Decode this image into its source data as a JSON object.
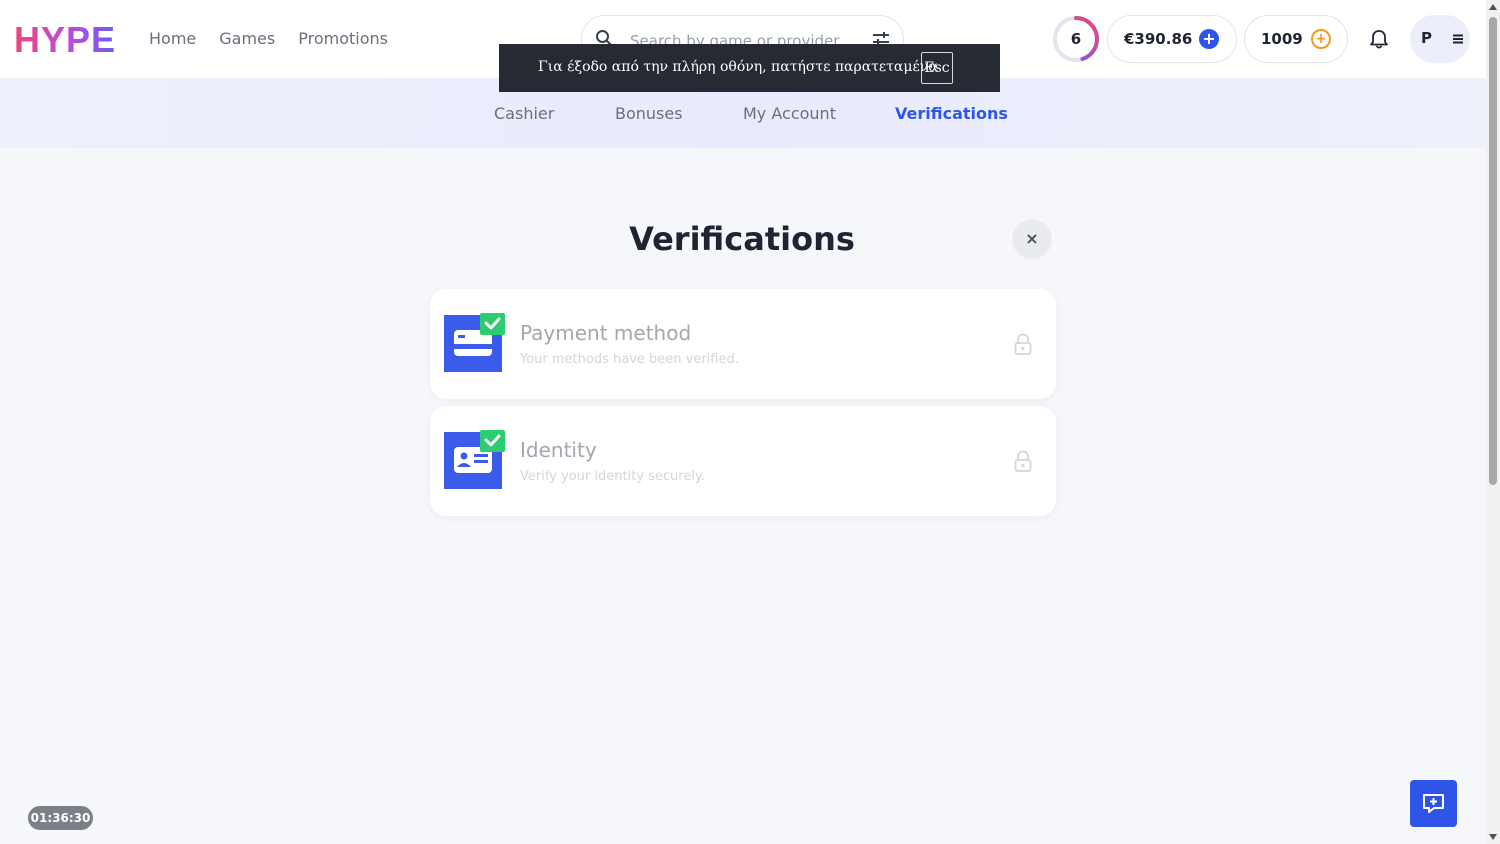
{
  "brand": {
    "logo_text": "HYPE"
  },
  "nav": {
    "items": [
      {
        "label": "Home"
      },
      {
        "label": "Games"
      },
      {
        "label": "Promotions"
      }
    ]
  },
  "search": {
    "placeholder": "Search by game or provider",
    "value": ""
  },
  "account": {
    "level": "6",
    "level_progress": 0.45,
    "balance": "€390.86",
    "points": "1009",
    "avatar_initial": "P"
  },
  "fullscreen_toast": {
    "message": "Για έξοδο από την πλήρη οθόνη, πατήστε παρατεταμένα",
    "key": "Esc"
  },
  "subnav": {
    "tabs": [
      {
        "label": "Cashier",
        "active": false
      },
      {
        "label": "Bonuses",
        "active": false
      },
      {
        "label": "My Account",
        "active": false
      },
      {
        "label": "Verifications",
        "active": true
      }
    ]
  },
  "main": {
    "title": "Verifications",
    "close_symbol": "×",
    "cards": [
      {
        "title": "Payment method",
        "subtitle": "Your methods have been verified.",
        "icon": "card-verified-icon",
        "status": "verified"
      },
      {
        "title": "Identity",
        "subtitle": "Verify your identity securely.",
        "icon": "id-verified-icon",
        "status": "verified"
      }
    ]
  },
  "footer": {
    "timer": "01:36:30"
  },
  "colors": {
    "accent": "#2f55e8",
    "check": "#2ecc71",
    "orange": "#f39a26"
  }
}
